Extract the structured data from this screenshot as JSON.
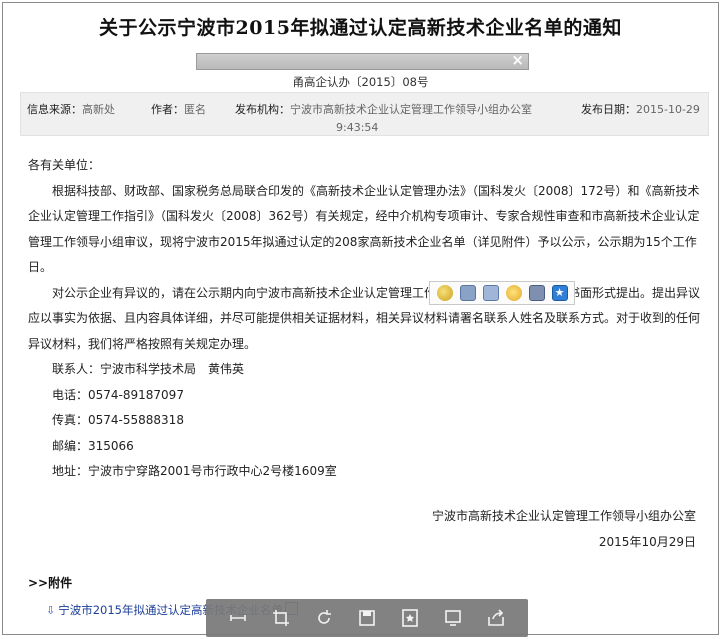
{
  "title": "关于公示宁波市2015年拟通过认定高新技术企业名单的通知",
  "overlay_close": "×",
  "doc_number": "甬高企认办〔2015〕08号",
  "meta": {
    "source_label": "信息来源：",
    "source_value": "高新处",
    "author_label": "作者：",
    "author_value": "匿名",
    "publisher_label": "发布机构：",
    "publisher_value": "宁波市高新技术企业认定管理工作领导小组办公室",
    "date_label": "发布日期：",
    "date_value": "2015-10-29",
    "time_value": "9:43:54"
  },
  "body": {
    "salutation": "各有关单位：",
    "para1": "根据科技部、财政部、国家税务总局联合印发的《高新技术企业认定管理办法》（国科发火〔2008〕172号）和《高新技术企业认定管理工作指引》（国科发火〔2008〕362号）有关规定，经中介机构专项审计、专家合规性审查和市高新技术企业认定管理工作领导小组审议，现将宁波市2015年拟通过认定的208家高新技术企业名单（详见附件）予以公示，公示期为15个工作日。",
    "para2": "对公示企业有异议的，请在公示期内向宁波市高新技术企业认定管理工作领导小组办公室以实名、书面形式提出。提出异议应以事实为依据、且内容具体详细，并尽可能提供相关证据材料，相关异议材料请署名联系人姓名及联系方式。对于收到的任何异议材料，我们将严格按照有关规定办理。",
    "contact_person": "联系人：宁波市科学技术局　黄伟英",
    "phone": "电话：0574-89187097",
    "fax": "传真：0574-55888318",
    "postcode": "邮编：315066",
    "address": "地址：宁波市宁穿路2001号市行政中心2号楼1609室"
  },
  "signature": {
    "org": "宁波市高新技术企业认定管理工作领导小组办公室",
    "date": "2015年10月29日"
  },
  "attachments": {
    "header": ">>附件",
    "items": [
      {
        "label": "宁波市2015年拟通过认定高新技术企业名单"
      }
    ]
  },
  "icons": {
    "float_toolbar": [
      "smiley-icon",
      "save-icon",
      "monitor-icon",
      "emoji-icon",
      "image-icon",
      "bookmark-icon"
    ],
    "viewer_toolbar": [
      "fit-icon",
      "crop-icon",
      "rotate-icon",
      "save-icon",
      "star-icon",
      "screen-icon",
      "share-icon"
    ]
  }
}
